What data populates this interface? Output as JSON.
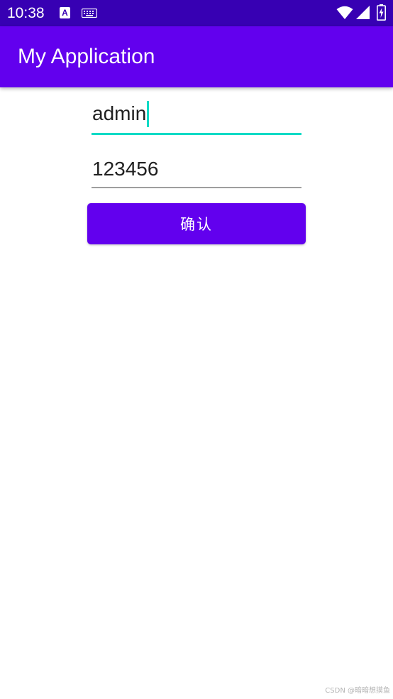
{
  "status_bar": {
    "time": "10:38",
    "notification_icon_letter": "A",
    "icons": [
      "a-notification-icon",
      "keyboard-icon",
      "wifi-icon",
      "signal-icon",
      "battery-charging-icon"
    ]
  },
  "app_bar": {
    "title": "My Application"
  },
  "form": {
    "username_value": "admin",
    "password_value": "123456",
    "confirm_label": "确认"
  },
  "watermark": "CSDN @暗暗想摸鱼",
  "colors": {
    "status_bar": "#3700b3",
    "primary": "#6200ee",
    "accent": "#03dac5",
    "underline_inactive": "#9e9e9e"
  }
}
